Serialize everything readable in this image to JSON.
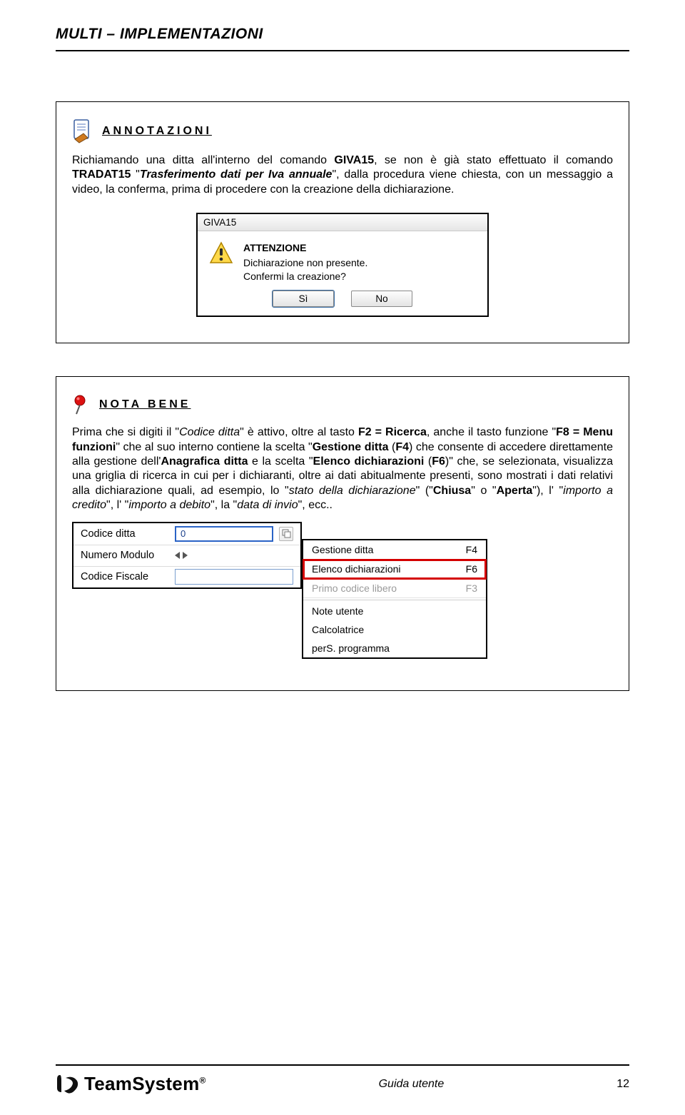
{
  "header": {
    "title": "MULTI – IMPLEMENTAZIONI"
  },
  "box1": {
    "title": "ANNOTAZIONI",
    "p_pre": "Richiamando una ditta all'interno del comando ",
    "t_giva": "GIVA15",
    "p_mid1": ", se non è già stato effettuato il comando ",
    "t_tradat": "TRADAT15",
    "p_mid2": " \"",
    "t_trasf": "Trasferimento dati per Iva annuale",
    "p_mid3": "\", dalla procedura viene chiesta, con un messaggio a video, la conferma, prima di procedere con la creazione della dichiarazione.",
    "dialog": {
      "title": "GIVA15",
      "att": "ATTENZIONE",
      "l1": "Dichiarazione non presente.",
      "l2": "Confermi la creazione?",
      "btn_yes": "Sì",
      "btn_no": "No"
    }
  },
  "box2": {
    "title": "NOTA BENE",
    "p_pre": "Prima che si digiti il \"",
    "i_codice": "Codice ditta",
    "p_a": "\" è attivo, oltre al tasto ",
    "b_f2": "F2 = Ricerca",
    "p_b": ", anche il tasto funzione \"",
    "b_f8": "F8 = Menu funzioni",
    "p_c": "\" che al suo interno contiene la scelta \"",
    "b_gest": "Gestione ditta",
    "p_d": " (",
    "b_f4": "F4",
    "p_e": ") che consente di accedere direttamente alla gestione dell'",
    "b_ana": "Anagrafica ditta",
    "p_f": " e la scelta \"",
    "b_elenco": "Elenco dichiarazioni",
    "p_g": " (",
    "b_f6": "F6",
    "p_h": ")\" che, se selezionata, visualizza una griglia di ricerca in cui per i dichiaranti, oltre ai dati abitualmente presenti, sono mostrati i dati relativi alla dichiarazione quali, ad esempio, lo \"",
    "i_stato": "stato della dichiarazione",
    "p_i": "\" (\"",
    "b_chiusa": "Chiusa",
    "p_j": "\" o \"",
    "b_aperta": "Aperta",
    "p_k": "\"), l' \"",
    "i_cred": "importo a credito",
    "p_l": "\", l' \"",
    "i_deb": "importo a debito",
    "p_m": "\", la \"",
    "i_data": "data di invio",
    "p_n": "\", ecc..",
    "panel_left": {
      "r1": "Codice ditta",
      "r1_val": "0",
      "r2": "Numero Modulo",
      "r3": "Codice Fiscale"
    },
    "panel_right": {
      "m1": "Gestione ditta",
      "k1": "F4",
      "m2": "Elenco dichiarazioni",
      "k2": "F6",
      "m3": "Primo codice libero",
      "k3": "F3",
      "m4": "Note utente",
      "m5": "Calcolatrice",
      "m6": "perS. programma"
    }
  },
  "footer": {
    "brand": "TeamSystem",
    "reg": "®",
    "center": "Guida utente",
    "page": "12"
  }
}
